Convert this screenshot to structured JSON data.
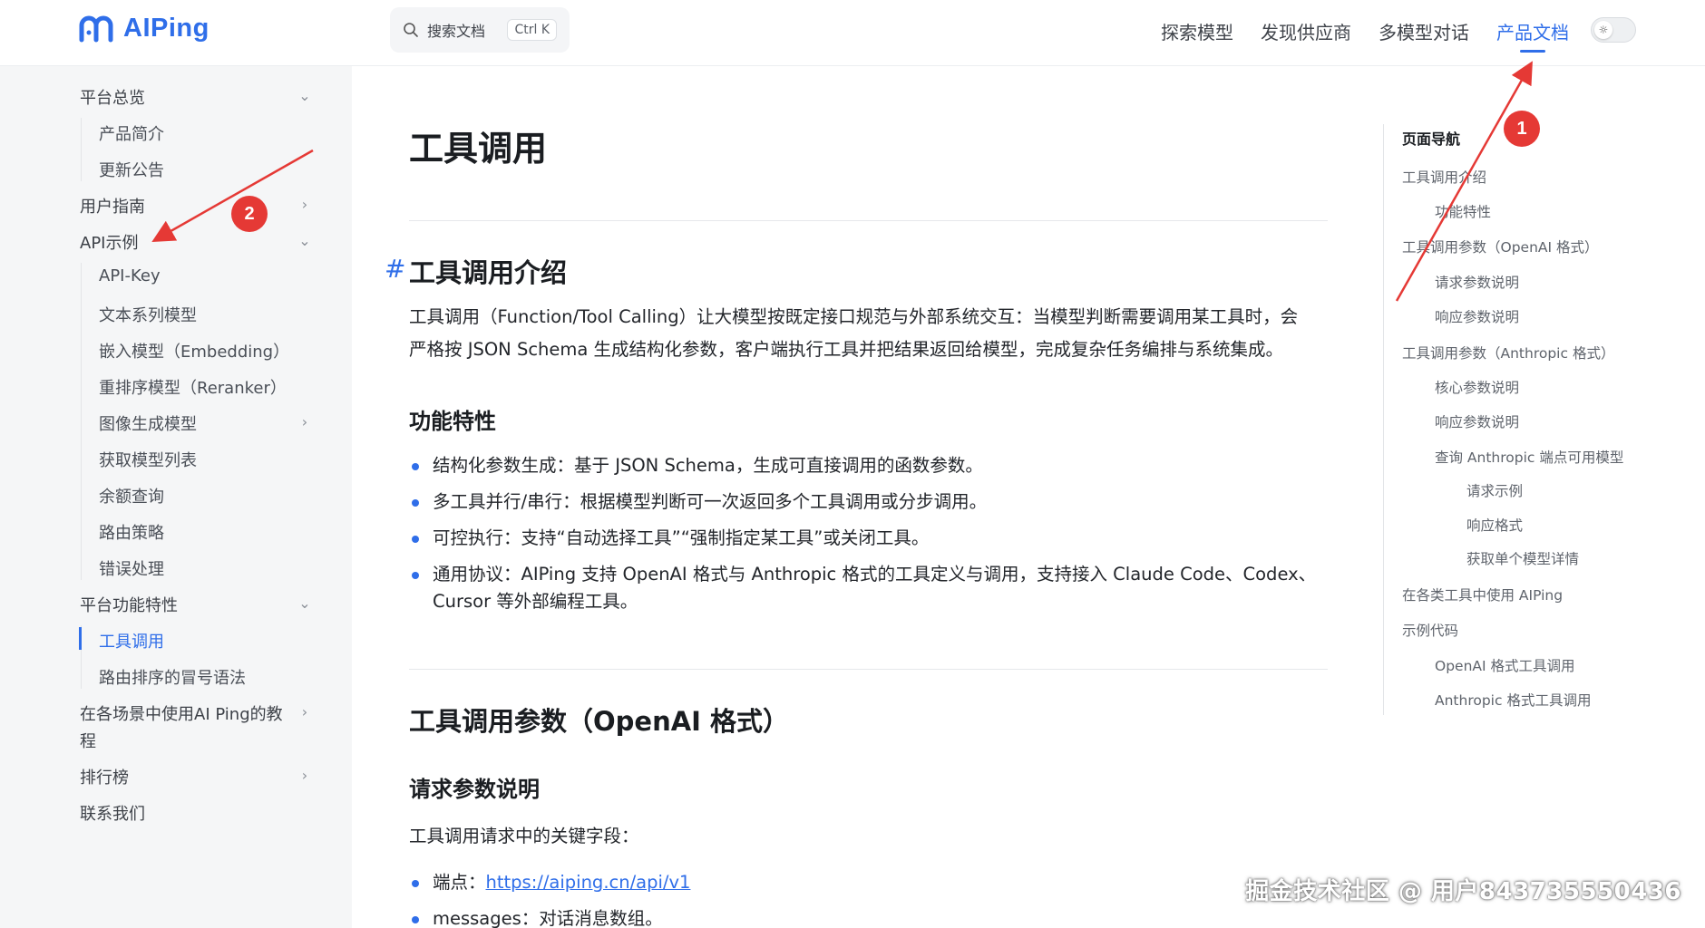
{
  "header": {
    "logo_text": "AIPing",
    "search_placeholder": "搜索文档",
    "search_shortcut": "Ctrl K",
    "nav": [
      "探索模型",
      "发现供应商",
      "多模型对话",
      "产品文档"
    ],
    "active_nav": "产品文档",
    "theme_toggle_icon": "sun-icon"
  },
  "sidebar": {
    "items": [
      {
        "label": "平台总览",
        "level": 1,
        "expanded": true
      },
      {
        "label": "产品简介",
        "level": 2
      },
      {
        "label": "更新公告",
        "level": 2
      },
      {
        "label": "用户指南",
        "level": 1,
        "expanded": false
      },
      {
        "label": "API示例",
        "level": 1,
        "expanded": true
      },
      {
        "label": "API-Key",
        "level": 2
      },
      {
        "label": "文本系列模型",
        "level": 2
      },
      {
        "label": "嵌入模型（Embedding）",
        "level": 2
      },
      {
        "label": "重排序模型（Reranker）",
        "level": 2
      },
      {
        "label": "图像生成模型",
        "level": 2,
        "expanded": false
      },
      {
        "label": "获取模型列表",
        "level": 2
      },
      {
        "label": "余额查询",
        "level": 2
      },
      {
        "label": "路由策略",
        "level": 2
      },
      {
        "label": "错误处理",
        "level": 2
      },
      {
        "label": "平台功能特性",
        "level": 1,
        "expanded": true
      },
      {
        "label": "工具调用",
        "level": 2,
        "active": true
      },
      {
        "label": "路由排序的冒号语法",
        "level": 2
      },
      {
        "label": "在各场景中使用AI Ping的教",
        "label_line2": "程",
        "level": 1,
        "expanded": false
      },
      {
        "label": "排行榜",
        "level": 1,
        "expanded": false
      },
      {
        "label": "联系我们",
        "level": 1
      }
    ]
  },
  "main": {
    "title": "工具调用",
    "section1": {
      "heading": "工具调用介绍",
      "paragraph_line1": "工具调用（Function/Tool Calling）让大模型按既定接口规范与外部系统交互：当模型判断需要调用某工具时，会",
      "paragraph_line2": "严格按 JSON Schema 生成结构化参数，客户端执行工具并把结果返回给模型，完成复杂任务编排与系统集成。",
      "features_heading": "功能特性",
      "features": [
        "结构化参数生成：基于 JSON Schema，生成可直接调用的函数参数。",
        "多工具并行/串行：根据模型判断可一次返回多个工具调用或分步调用。",
        "可控执行：支持“自动选择工具”“强制指定某工具”或关闭工具。",
        "通用协议：AIPing 支持 OpenAI 格式与 Anthropic 格式的工具定义与调用，支持接入 Claude Code、Codex、",
        "Cursor 等外部编程工具。"
      ]
    },
    "section2": {
      "heading": "工具调用参数（OpenAI 格式）",
      "sub_heading": "请求参数说明",
      "intro": "工具调用请求中的关键字段：",
      "endpoint_label": "端点：",
      "endpoint_url": "https://aiping.cn/api/v1",
      "messages_item": "messages：对话消息数组。"
    }
  },
  "toc": {
    "title": "页面导航",
    "items": [
      {
        "label": "工具调用介绍",
        "level": 1
      },
      {
        "label": "功能特性",
        "level": 2
      },
      {
        "label": "工具调用参数（OpenAI 格式）",
        "level": 1
      },
      {
        "label": "请求参数说明",
        "level": 2
      },
      {
        "label": "响应参数说明",
        "level": 2
      },
      {
        "label": "工具调用参数（Anthropic 格式）",
        "level": 1
      },
      {
        "label": "核心参数说明",
        "level": 2
      },
      {
        "label": "响应参数说明",
        "level": 2
      },
      {
        "label": "查询 Anthropic 端点可用模型",
        "level": 2
      },
      {
        "label": "请求示例",
        "level": 3
      },
      {
        "label": "响应格式",
        "level": 3
      },
      {
        "label": "获取单个模型详情",
        "level": 3
      },
      {
        "label": "在各类工具中使用 AIPing",
        "level": 1
      },
      {
        "label": "示例代码",
        "level": 1
      },
      {
        "label": "OpenAI 格式工具调用",
        "level": 2
      },
      {
        "label": "Anthropic 格式工具调用",
        "level": 2
      }
    ]
  },
  "annotations": {
    "badge1": "1",
    "badge2": "2",
    "color": "#e53935"
  },
  "watermark": "掘金技术社区 @ 用户843735550436",
  "colors": {
    "accent": "#2f6ee9",
    "sidebar_bg": "#f5f6f7",
    "annotation_red": "#e53935"
  }
}
